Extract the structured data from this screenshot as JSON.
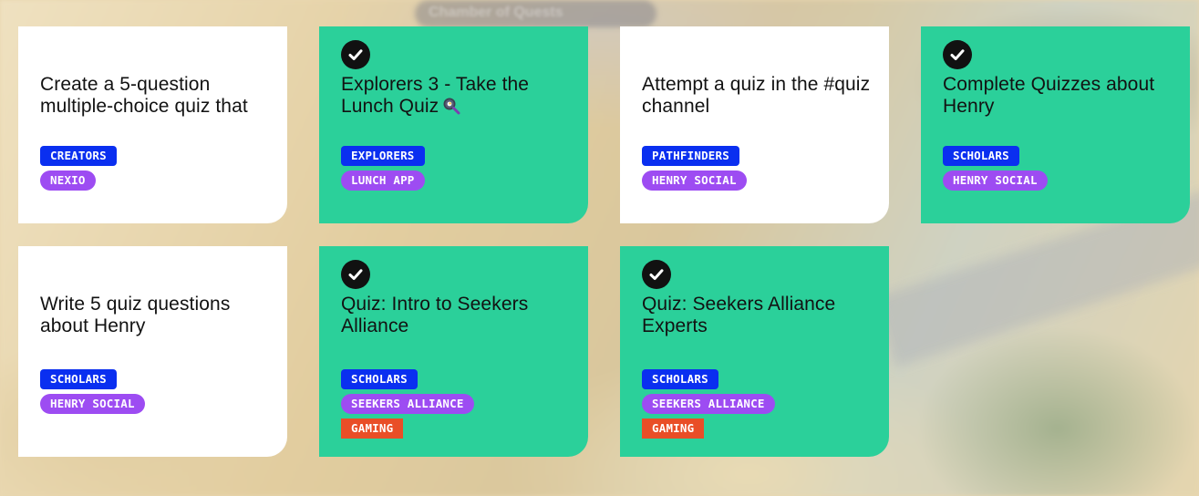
{
  "background": {
    "banner_text": "Chamber of Quests"
  },
  "cards": [
    {
      "title": "Create a 5-question multiple-choice quiz that",
      "completed": false,
      "tags": [
        {
          "label": "CREATORS",
          "style": "blue"
        },
        {
          "label": "NEXIO",
          "style": "purple"
        }
      ]
    },
    {
      "title": "Explorers 3 - Take the Lunch Quiz",
      "title_icon": "frying-pan-icon",
      "completed": true,
      "tags": [
        {
          "label": "EXPLORERS",
          "style": "blue"
        },
        {
          "label": "LUNCH APP",
          "style": "purple"
        }
      ]
    },
    {
      "title": "Attempt a quiz in the #quiz channel",
      "completed": false,
      "tags": [
        {
          "label": "PATHFINDERS",
          "style": "blue"
        },
        {
          "label": "HENRY SOCIAL",
          "style": "purple"
        }
      ]
    },
    {
      "title": "Complete Quizzes about Henry",
      "completed": true,
      "tags": [
        {
          "label": "SCHOLARS",
          "style": "blue"
        },
        {
          "label": "HENRY SOCIAL",
          "style": "purple"
        }
      ]
    },
    {
      "title": "Write 5 quiz questions about Henry",
      "completed": false,
      "tags": [
        {
          "label": "SCHOLARS",
          "style": "blue"
        },
        {
          "label": "HENRY SOCIAL",
          "style": "purple"
        }
      ]
    },
    {
      "title": "Quiz: Intro to Seekers Alliance",
      "completed": true,
      "tags": [
        {
          "label": "SCHOLARS",
          "style": "blue"
        },
        {
          "label": "SEEKERS ALLIANCE",
          "style": "purple"
        },
        {
          "label": "GAMING",
          "style": "red"
        }
      ]
    },
    {
      "title": "Quiz: Seekers Alliance Experts",
      "completed": true,
      "tags": [
        {
          "label": "SCHOLARS",
          "style": "blue"
        },
        {
          "label": "SEEKERS ALLIANCE",
          "style": "purple"
        },
        {
          "label": "GAMING",
          "style": "red"
        }
      ]
    }
  ],
  "colors": {
    "completed_card": "#2bd09a",
    "open_card": "#ffffff",
    "tag_blue": "#0a2ff0",
    "tag_purple": "#9d4cf2",
    "tag_red": "#e94e27",
    "checkmark": "#111111"
  },
  "icons": {
    "completed": "check-circle-icon"
  }
}
